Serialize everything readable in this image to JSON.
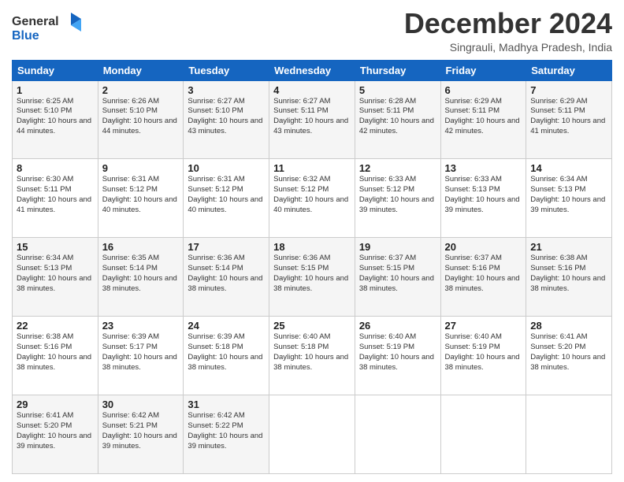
{
  "logo": {
    "line1": "General",
    "line2": "Blue"
  },
  "title": "December 2024",
  "subtitle": "Singrauli, Madhya Pradesh, India",
  "weekdays": [
    "Sunday",
    "Monday",
    "Tuesday",
    "Wednesday",
    "Thursday",
    "Friday",
    "Saturday"
  ],
  "weeks": [
    [
      {
        "day": "1",
        "sunrise": "6:25 AM",
        "sunset": "5:10 PM",
        "daylight": "10 hours and 44 minutes."
      },
      {
        "day": "2",
        "sunrise": "6:26 AM",
        "sunset": "5:10 PM",
        "daylight": "10 hours and 44 minutes."
      },
      {
        "day": "3",
        "sunrise": "6:27 AM",
        "sunset": "5:10 PM",
        "daylight": "10 hours and 43 minutes."
      },
      {
        "day": "4",
        "sunrise": "6:27 AM",
        "sunset": "5:11 PM",
        "daylight": "10 hours and 43 minutes."
      },
      {
        "day": "5",
        "sunrise": "6:28 AM",
        "sunset": "5:11 PM",
        "daylight": "10 hours and 42 minutes."
      },
      {
        "day": "6",
        "sunrise": "6:29 AM",
        "sunset": "5:11 PM",
        "daylight": "10 hours and 42 minutes."
      },
      {
        "day": "7",
        "sunrise": "6:29 AM",
        "sunset": "5:11 PM",
        "daylight": "10 hours and 41 minutes."
      }
    ],
    [
      {
        "day": "8",
        "sunrise": "6:30 AM",
        "sunset": "5:11 PM",
        "daylight": "10 hours and 41 minutes."
      },
      {
        "day": "9",
        "sunrise": "6:31 AM",
        "sunset": "5:12 PM",
        "daylight": "10 hours and 40 minutes."
      },
      {
        "day": "10",
        "sunrise": "6:31 AM",
        "sunset": "5:12 PM",
        "daylight": "10 hours and 40 minutes."
      },
      {
        "day": "11",
        "sunrise": "6:32 AM",
        "sunset": "5:12 PM",
        "daylight": "10 hours and 40 minutes."
      },
      {
        "day": "12",
        "sunrise": "6:33 AM",
        "sunset": "5:12 PM",
        "daylight": "10 hours and 39 minutes."
      },
      {
        "day": "13",
        "sunrise": "6:33 AM",
        "sunset": "5:13 PM",
        "daylight": "10 hours and 39 minutes."
      },
      {
        "day": "14",
        "sunrise": "6:34 AM",
        "sunset": "5:13 PM",
        "daylight": "10 hours and 39 minutes."
      }
    ],
    [
      {
        "day": "15",
        "sunrise": "6:34 AM",
        "sunset": "5:13 PM",
        "daylight": "10 hours and 38 minutes."
      },
      {
        "day": "16",
        "sunrise": "6:35 AM",
        "sunset": "5:14 PM",
        "daylight": "10 hours and 38 minutes."
      },
      {
        "day": "17",
        "sunrise": "6:36 AM",
        "sunset": "5:14 PM",
        "daylight": "10 hours and 38 minutes."
      },
      {
        "day": "18",
        "sunrise": "6:36 AM",
        "sunset": "5:15 PM",
        "daylight": "10 hours and 38 minutes."
      },
      {
        "day": "19",
        "sunrise": "6:37 AM",
        "sunset": "5:15 PM",
        "daylight": "10 hours and 38 minutes."
      },
      {
        "day": "20",
        "sunrise": "6:37 AM",
        "sunset": "5:16 PM",
        "daylight": "10 hours and 38 minutes."
      },
      {
        "day": "21",
        "sunrise": "6:38 AM",
        "sunset": "5:16 PM",
        "daylight": "10 hours and 38 minutes."
      }
    ],
    [
      {
        "day": "22",
        "sunrise": "6:38 AM",
        "sunset": "5:16 PM",
        "daylight": "10 hours and 38 minutes."
      },
      {
        "day": "23",
        "sunrise": "6:39 AM",
        "sunset": "5:17 PM",
        "daylight": "10 hours and 38 minutes."
      },
      {
        "day": "24",
        "sunrise": "6:39 AM",
        "sunset": "5:18 PM",
        "daylight": "10 hours and 38 minutes."
      },
      {
        "day": "25",
        "sunrise": "6:40 AM",
        "sunset": "5:18 PM",
        "daylight": "10 hours and 38 minutes."
      },
      {
        "day": "26",
        "sunrise": "6:40 AM",
        "sunset": "5:19 PM",
        "daylight": "10 hours and 38 minutes."
      },
      {
        "day": "27",
        "sunrise": "6:40 AM",
        "sunset": "5:19 PM",
        "daylight": "10 hours and 38 minutes."
      },
      {
        "day": "28",
        "sunrise": "6:41 AM",
        "sunset": "5:20 PM",
        "daylight": "10 hours and 38 minutes."
      }
    ],
    [
      {
        "day": "29",
        "sunrise": "6:41 AM",
        "sunset": "5:20 PM",
        "daylight": "10 hours and 39 minutes."
      },
      {
        "day": "30",
        "sunrise": "6:42 AM",
        "sunset": "5:21 PM",
        "daylight": "10 hours and 39 minutes."
      },
      {
        "day": "31",
        "sunrise": "6:42 AM",
        "sunset": "5:22 PM",
        "daylight": "10 hours and 39 minutes."
      },
      null,
      null,
      null,
      null
    ]
  ],
  "labels": {
    "sunrise": "Sunrise:",
    "sunset": "Sunset:",
    "daylight": "Daylight:"
  }
}
